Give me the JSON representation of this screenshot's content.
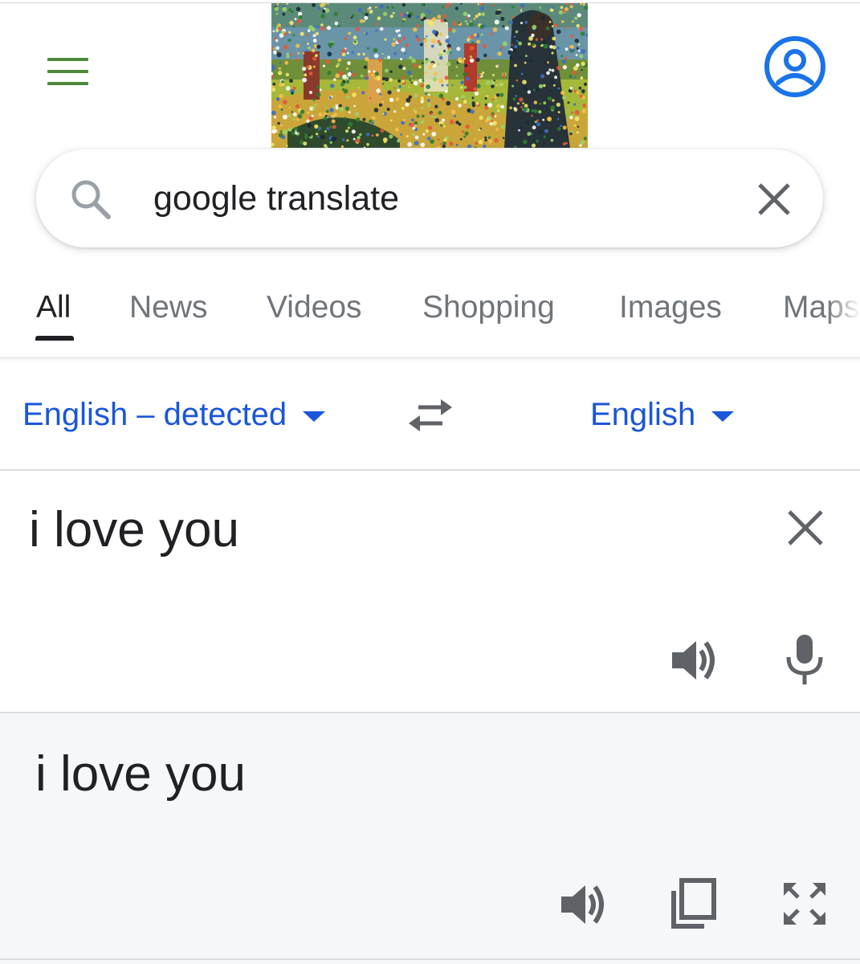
{
  "header": {
    "menu_icon": "hamburger-menu-icon",
    "doodle": "google-doodle-pointillist-painting",
    "account_icon": "account-circle-icon",
    "accent_color": "#4f8a3c",
    "account_color": "#1a73e8"
  },
  "search": {
    "query": "google translate",
    "search_icon": "search-icon",
    "clear_icon": "close-icon"
  },
  "tabs": [
    {
      "label": "All",
      "active": true
    },
    {
      "label": "News",
      "active": false
    },
    {
      "label": "Videos",
      "active": false
    },
    {
      "label": "Shopping",
      "active": false
    },
    {
      "label": "Images",
      "active": false
    },
    {
      "label": "Maps",
      "active": false
    }
  ],
  "translator": {
    "source_language": "English – detected",
    "target_language": "English",
    "link_color": "#1a56d9",
    "source_text": "i love you",
    "result_text": "i love you",
    "icons": {
      "swap": "swap-languages-icon",
      "clear": "close-icon",
      "listen_source": "speaker-icon",
      "microphone": "microphone-icon",
      "listen_result": "speaker-icon",
      "copy": "copy-icon",
      "fullscreen": "fullscreen-icon"
    }
  }
}
